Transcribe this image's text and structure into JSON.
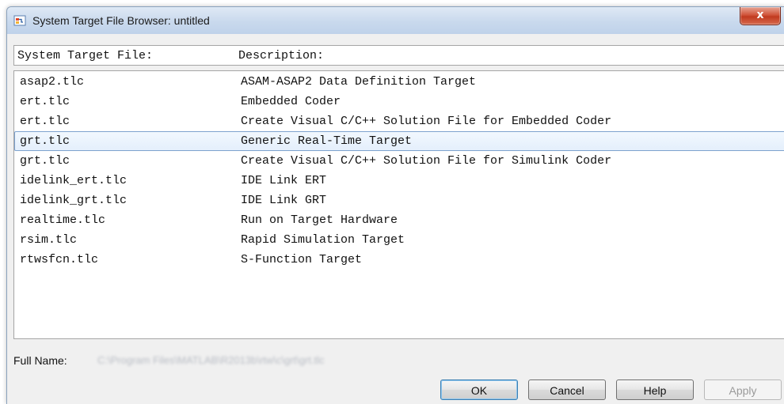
{
  "window": {
    "title": "System Target File Browser: untitled",
    "close_label": "x"
  },
  "columns": {
    "file": "System Target File:",
    "description": "Description:"
  },
  "rows": [
    {
      "file": "asap2.tlc",
      "description": "ASAM-ASAP2 Data Definition Target"
    },
    {
      "file": "ert.tlc",
      "description": "Embedded Coder"
    },
    {
      "file": "ert.tlc",
      "description": "Create Visual C/C++ Solution File for Embedded Coder"
    },
    {
      "file": "grt.tlc",
      "description": "Generic Real-Time Target",
      "selected": true
    },
    {
      "file": "grt.tlc",
      "description": "Create Visual C/C++ Solution File for Simulink Coder"
    },
    {
      "file": "idelink_ert.tlc",
      "description": "IDE Link ERT"
    },
    {
      "file": "idelink_grt.tlc",
      "description": "IDE Link GRT"
    },
    {
      "file": "realtime.tlc",
      "description": "Run on Target Hardware"
    },
    {
      "file": "rsim.tlc",
      "description": "Rapid Simulation Target"
    },
    {
      "file": "rtwsfcn.tlc",
      "description": "S-Function Target"
    }
  ],
  "full_name": {
    "label": "Full Name:",
    "value": "C:\\Program Files\\MATLAB\\R2013b\\rtw\\c\\grt\\grt.tlc"
  },
  "buttons": {
    "ok": "OK",
    "cancel": "Cancel",
    "help": "Help",
    "apply": "Apply"
  }
}
